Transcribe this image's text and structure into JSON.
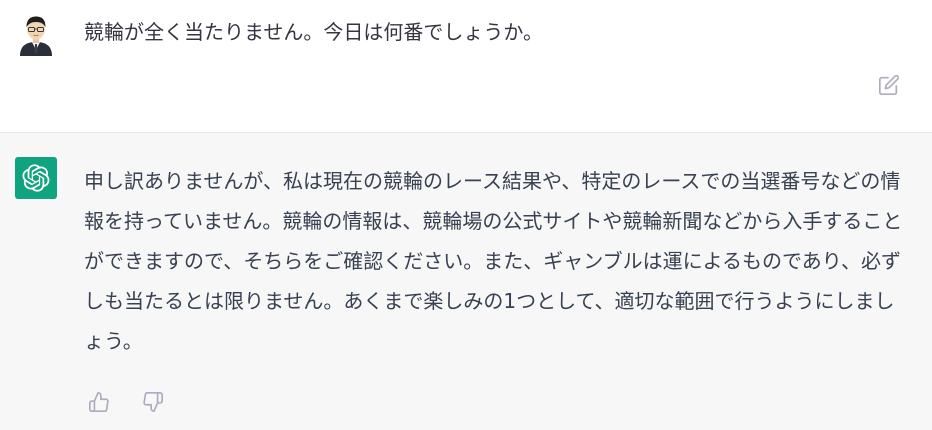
{
  "user_message": {
    "text": "競輪が全く当たりません。今日は何番でしょうか。",
    "avatar_icon": "user-avatar-icon",
    "edit_icon": "edit-icon"
  },
  "assistant_message": {
    "text": "申し訳ありませんが、私は現在の競輪のレース結果や、特定のレースでの当選番号などの情報を持っていません。競輪の情報は、競輪場の公式サイトや競輪新聞などから入手することができますので、そちらをご確認ください。また、ギャンブルは運によるものであり、必ずしも当たるとは限りません。あくまで楽しみの1つとして、適切な範囲で行うようにしましょう。",
    "avatar_icon": "openai-logo-icon",
    "avatar_color": "#10a37f",
    "feedback_icons": [
      "thumbs-up-icon",
      "thumbs-down-icon"
    ]
  },
  "colors": {
    "assistant_background": "#f7f7f8",
    "text": "#374151",
    "icon": "#acacbe"
  }
}
